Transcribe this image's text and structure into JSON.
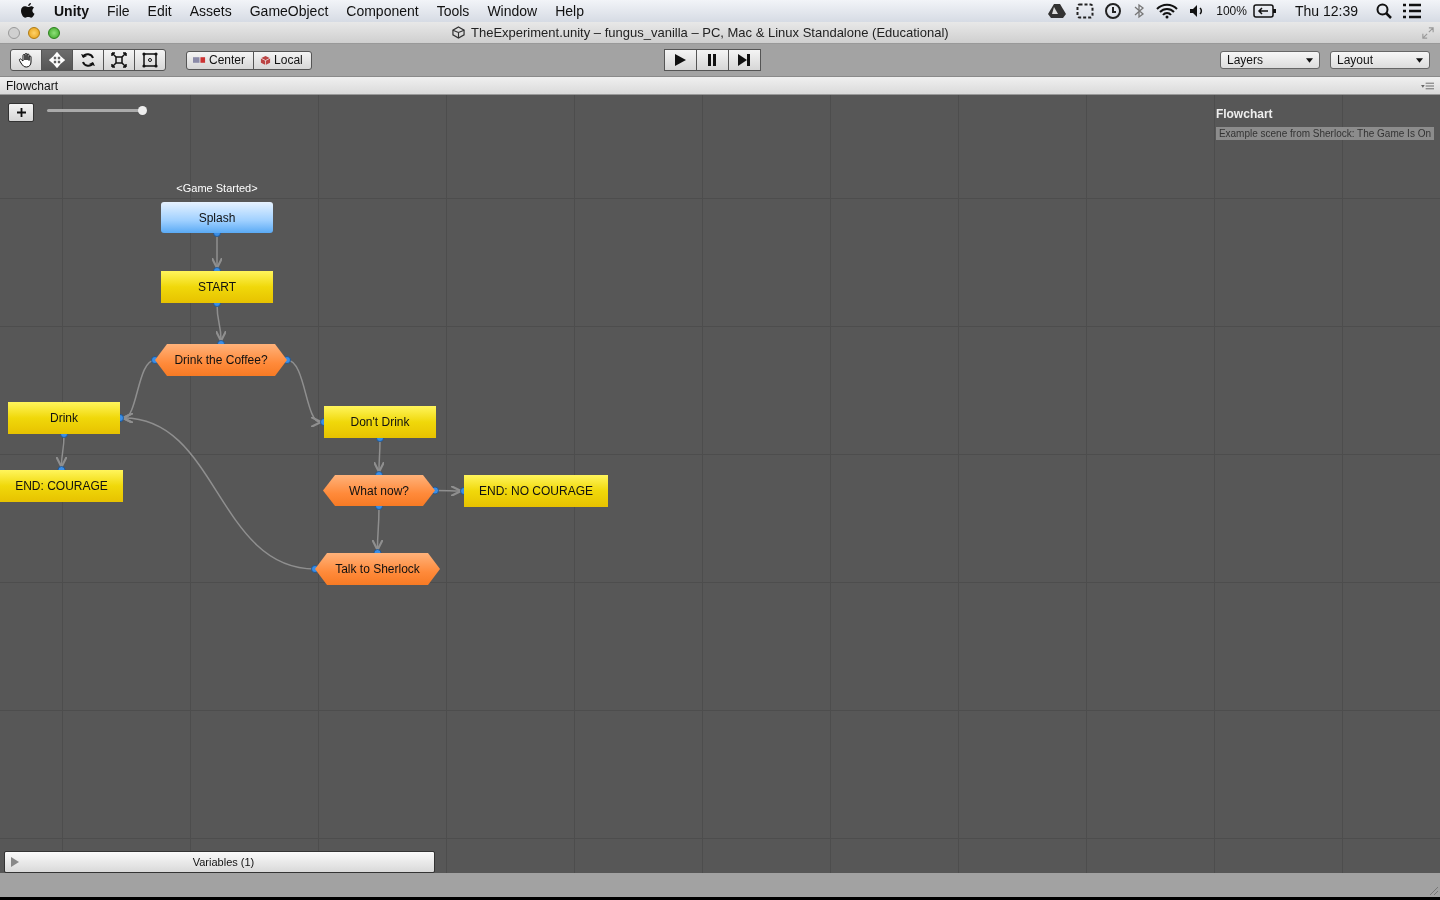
{
  "menu_bar": {
    "app": "Unity",
    "items": [
      "File",
      "Edit",
      "Assets",
      "GameObject",
      "Component",
      "Tools",
      "Window",
      "Help"
    ],
    "battery": "100%",
    "clock": "Thu 12:39"
  },
  "window": {
    "title": "TheExperiment.unity – fungus_vanilla – PC, Mac & Linux Standalone (Educational)"
  },
  "toolbar": {
    "tools": [
      {
        "kind": "hand",
        "selected": false
      },
      {
        "kind": "move",
        "selected": true
      },
      {
        "kind": "rotate",
        "selected": false
      },
      {
        "kind": "scale",
        "selected": false
      },
      {
        "kind": "rect",
        "selected": false
      }
    ],
    "pivot": [
      "Center",
      "Local"
    ],
    "dropdowns": [
      "Layers",
      "Layout"
    ]
  },
  "tab": {
    "label": "Flowchart"
  },
  "flowchart": {
    "zoom": {
      "level": 1
    },
    "name": "Flowchart",
    "description": "Example scene from Sherlock: The Game Is On",
    "nodes": [
      {
        "label": "Splash",
        "kind": "event",
        "event": "<Game Started>"
      },
      {
        "label": "START",
        "kind": "block"
      },
      {
        "label": "Drink the Coffee?",
        "kind": "choice"
      },
      {
        "label": "Drink",
        "kind": "block"
      },
      {
        "label": "Don't Drink",
        "kind": "block"
      },
      {
        "label": "END: COURAGE",
        "kind": "block"
      },
      {
        "label": "What now?",
        "kind": "choice"
      },
      {
        "label": "END: NO COURAGE",
        "kind": "block"
      },
      {
        "label": "Talk to Sherlock",
        "kind": "choice"
      }
    ]
  },
  "variables": {
    "label": "Variables (1)",
    "expanded": false
  }
}
